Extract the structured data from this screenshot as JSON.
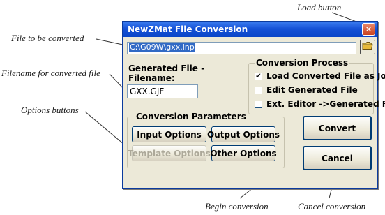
{
  "annotations": {
    "load_button": "Load button",
    "file_to_convert": "File to be converted",
    "filename_converted": "Filename for converted file",
    "options_buttons": "Options buttons",
    "begin_conversion": "Begin conversion",
    "cancel_conversion": "Cancel conversion"
  },
  "window": {
    "title": "NewZMat File Conversion",
    "close_symbol": "✕"
  },
  "file_input": {
    "value": "C:\\G09W\\gxx.inp"
  },
  "load_button_icon": "folder-icon",
  "generated_file": {
    "label_line1": "Generated File -",
    "label_line2": "Filename:",
    "value": "GXX.GJF"
  },
  "conversion_process": {
    "title": "Conversion Process",
    "options": [
      {
        "label": "Load Converted File as Job",
        "checked": true
      },
      {
        "label": "Edit Generated File",
        "checked": false
      },
      {
        "label": "Ext. Editor ->Generated File",
        "checked": false
      }
    ]
  },
  "conversion_parameters": {
    "title": "Conversion Parameters",
    "input_options": "Input Options",
    "output_options": "Output Options",
    "template_options": "Template Options",
    "other_options": "Other Options"
  },
  "actions": {
    "convert": "Convert",
    "cancel": "Cancel"
  },
  "colors": {
    "titlebar": "#0a46c8",
    "dialog_bg": "#ece9d8",
    "selection": "#316ac5",
    "close_button": "#c9421f"
  }
}
